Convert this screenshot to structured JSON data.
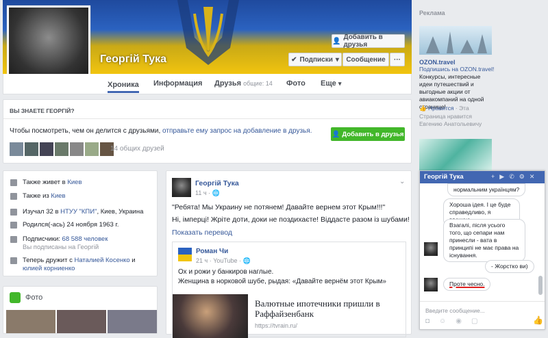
{
  "profile": {
    "name": "Георгій Тука",
    "add_friend": "Добавить в друзья",
    "follow": "Подписки",
    "message": "Сообщение",
    "tabs": {
      "timeline": "Хроника",
      "about": "Информация",
      "friends": "Друзья",
      "friends_sub": "общие: 14",
      "photos": "Фото",
      "more": "Еще"
    }
  },
  "know": {
    "title": "ВЫ ЗНАЕТЕ ГЕОРГІЙ?",
    "text_a": "Чтобы посмотреть, чем он делится с друзьями, ",
    "text_link": "отправьте ему запрос на добавление в друзья.",
    "add_btn": "Добавить в друзья",
    "mutual": "14 общих друзей"
  },
  "intro": {
    "lives_a": "Также живет в ",
    "lives_city": "Киев",
    "from_a": "Также из ",
    "from_city": "Киев",
    "studied_a": "Изучал 32 в ",
    "studied_link": "НТУУ \"КПИ\"",
    "studied_b": ", ",
    "studied_city": "Киев, Украина",
    "born": "Родился(-ась) 24 ноября 1963 г.",
    "followers_a": "Подписчики: ",
    "followers_count": "68 588 человек",
    "followers_sub": "Вы подписаны на Георгій",
    "friends_a": "Теперь дружит с ",
    "friends_p1": "Наталией Косенко",
    "friends_mid": " и ",
    "friends_p2": "юлией корниенко"
  },
  "photos_title": "Фото",
  "post": {
    "author": "Георгій Тука",
    "time": "11 ч · ",
    "text1": "\"Ребята! Мы Украину не потянем! Давайте вернем этот Крым!!!\"",
    "text2": "Ні, імперці! Жріте доти, доки не поздихаєте! Віддасте разом із шубами!",
    "translate": "Показать перевод",
    "share_author": "Роман Чи",
    "share_time": "21 ч · YouTube · ",
    "share_text1": "Ох и рожи у банкиров наглые.",
    "share_text2": "Женщина в норковой шубе, рыдая: «Давайте вернём этот Крым»",
    "link_title": "Валютные ипотечники пришли в Раффайзенбанк",
    "link_url": "https://tvrain.ru/"
  },
  "ad": {
    "header": "Реклама",
    "brand": "OZON.travel",
    "sub": "Подпишись на OZON.travel!",
    "desc": "Конкурсы, интересные идеи путешествий и выгодные акции от авиакомпаний на одной странице!",
    "like": "Нравится",
    "like_sep": " · Эта",
    "liked_by": "Страница нравится Евгению Анатольевичу"
  },
  "chat": {
    "title": "Георгій Тука",
    "msgs": [
      "нормальним українцям?",
      "Хороша ідея. І це буде справедливо, я вважаю.",
      "Взагалі, після усього того, що сепари нам принесли - вата в принципі не має права на існування.",
      "- Жорстко ви)",
      "Проте чесно."
    ],
    "placeholder": "Введите сообщение..."
  },
  "colors": {
    "fb_blue": "#4267b2",
    "green": "#42b72a",
    "red_underline": "#e02020"
  }
}
